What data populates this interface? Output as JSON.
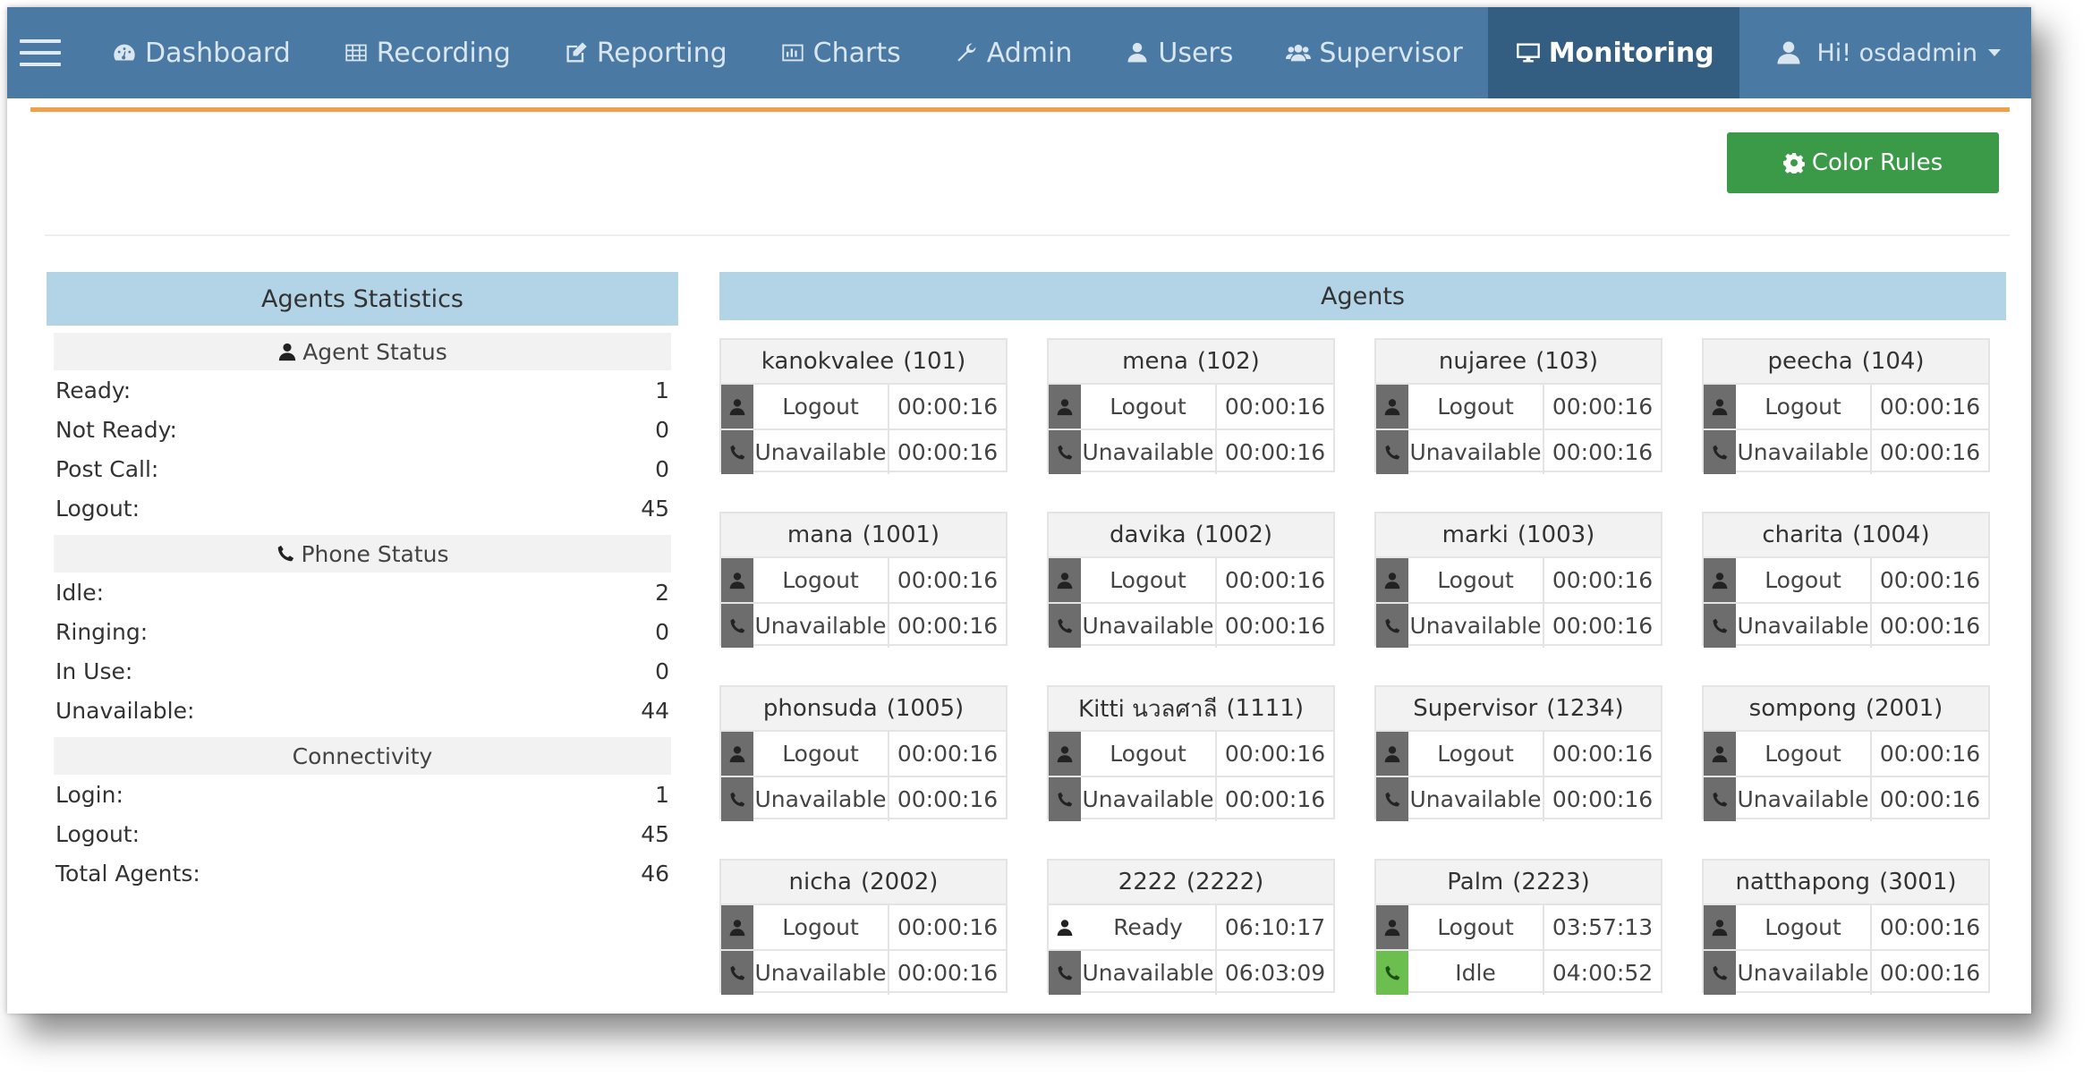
{
  "nav": {
    "items": [
      {
        "label": "Dashboard",
        "icon": "dashboard-icon"
      },
      {
        "label": "Recording",
        "icon": "table-icon"
      },
      {
        "label": "Reporting",
        "icon": "edit-icon"
      },
      {
        "label": "Charts",
        "icon": "chart-icon"
      },
      {
        "label": "Admin",
        "icon": "wrench-icon"
      },
      {
        "label": "Users",
        "icon": "user-icon"
      },
      {
        "label": "Supervisor",
        "icon": "users-icon"
      },
      {
        "label": "Monitoring",
        "icon": "monitor-icon",
        "active": true
      }
    ],
    "user_label": "Hi! osdadmin"
  },
  "color_rules_label": "Color Rules",
  "stats": {
    "title": "Agents Statistics",
    "agent_status": {
      "title": "Agent Status",
      "rows": [
        {
          "label": "Ready:",
          "value": "1"
        },
        {
          "label": "Not Ready:",
          "value": "0"
        },
        {
          "label": "Post Call:",
          "value": "0"
        },
        {
          "label": "Logout:",
          "value": "45"
        }
      ]
    },
    "phone_status": {
      "title": "Phone Status",
      "rows": [
        {
          "label": "Idle:",
          "value": "2"
        },
        {
          "label": "Ringing:",
          "value": "0"
        },
        {
          "label": "In Use:",
          "value": "0"
        },
        {
          "label": "Unavailable:",
          "value": "44"
        }
      ]
    },
    "connectivity": {
      "title": "Connectivity",
      "rows": [
        {
          "label": "Login:",
          "value": "1"
        },
        {
          "label": "Logout:",
          "value": "45"
        },
        {
          "label": "Total Agents:",
          "value": "46"
        }
      ]
    }
  },
  "agents": {
    "title": "Agents",
    "cards": [
      {
        "name": "kanokvalee",
        "ext": "(101)",
        "agent_status": "Logout",
        "agent_time": "00:00:16",
        "phone_status": "Unavailable",
        "phone_time": "00:00:16"
      },
      {
        "name": "mena",
        "ext": "(102)",
        "agent_status": "Logout",
        "agent_time": "00:00:16",
        "phone_status": "Unavailable",
        "phone_time": "00:00:16"
      },
      {
        "name": "nujaree",
        "ext": "(103)",
        "agent_status": "Logout",
        "agent_time": "00:00:16",
        "phone_status": "Unavailable",
        "phone_time": "00:00:16"
      },
      {
        "name": "peecha",
        "ext": "(104)",
        "agent_status": "Logout",
        "agent_time": "00:00:16",
        "phone_status": "Unavailable",
        "phone_time": "00:00:16"
      },
      {
        "name": "mana",
        "ext": "(1001)",
        "agent_status": "Logout",
        "agent_time": "00:00:16",
        "phone_status": "Unavailable",
        "phone_time": "00:00:16"
      },
      {
        "name": "davika",
        "ext": "(1002)",
        "agent_status": "Logout",
        "agent_time": "00:00:16",
        "phone_status": "Unavailable",
        "phone_time": "00:00:16"
      },
      {
        "name": "marki",
        "ext": "(1003)",
        "agent_status": "Logout",
        "agent_time": "00:00:16",
        "phone_status": "Unavailable",
        "phone_time": "00:00:16"
      },
      {
        "name": "charita",
        "ext": "(1004)",
        "agent_status": "Logout",
        "agent_time": "00:00:16",
        "phone_status": "Unavailable",
        "phone_time": "00:00:16"
      },
      {
        "name": "phonsuda",
        "ext": "(1005)",
        "agent_status": "Logout",
        "agent_time": "00:00:16",
        "phone_status": "Unavailable",
        "phone_time": "00:00:16"
      },
      {
        "name": "Kitti นวลศาลี",
        "ext": "(1111)",
        "agent_status": "Logout",
        "agent_time": "00:00:16",
        "phone_status": "Unavailable",
        "phone_time": "00:00:16"
      },
      {
        "name": "Supervisor",
        "ext": "(1234)",
        "agent_status": "Logout",
        "agent_time": "00:00:16",
        "phone_status": "Unavailable",
        "phone_time": "00:00:16"
      },
      {
        "name": "sompong",
        "ext": "(2001)",
        "agent_status": "Logout",
        "agent_time": "00:00:16",
        "phone_status": "Unavailable",
        "phone_time": "00:00:16"
      },
      {
        "name": "nicha",
        "ext": "(2002)",
        "agent_status": "Logout",
        "agent_time": "00:00:16",
        "phone_status": "Unavailable",
        "phone_time": "00:00:16"
      },
      {
        "name": "2222",
        "ext": "(2222)",
        "agent_status": "Ready",
        "agent_time": "06:10:17",
        "phone_status": "Unavailable",
        "phone_time": "06:03:09",
        "agent_icon_style": "white"
      },
      {
        "name": "Palm",
        "ext": "(2223)",
        "agent_status": "Logout",
        "agent_time": "03:57:13",
        "phone_status": "Idle",
        "phone_time": "04:00:52",
        "phone_icon_style": "green"
      },
      {
        "name": "natthapong",
        "ext": "(3001)",
        "agent_status": "Logout",
        "agent_time": "00:00:16",
        "phone_status": "Unavailable",
        "phone_time": "00:00:16"
      }
    ]
  },
  "colors": {
    "navbar": "#4a7aa3",
    "navbar_active": "#335e82",
    "accent_line": "#f0a04b",
    "button_green": "#3a9a47",
    "panel_header": "#b2d4e6",
    "idle_green": "#6cbf4f"
  }
}
